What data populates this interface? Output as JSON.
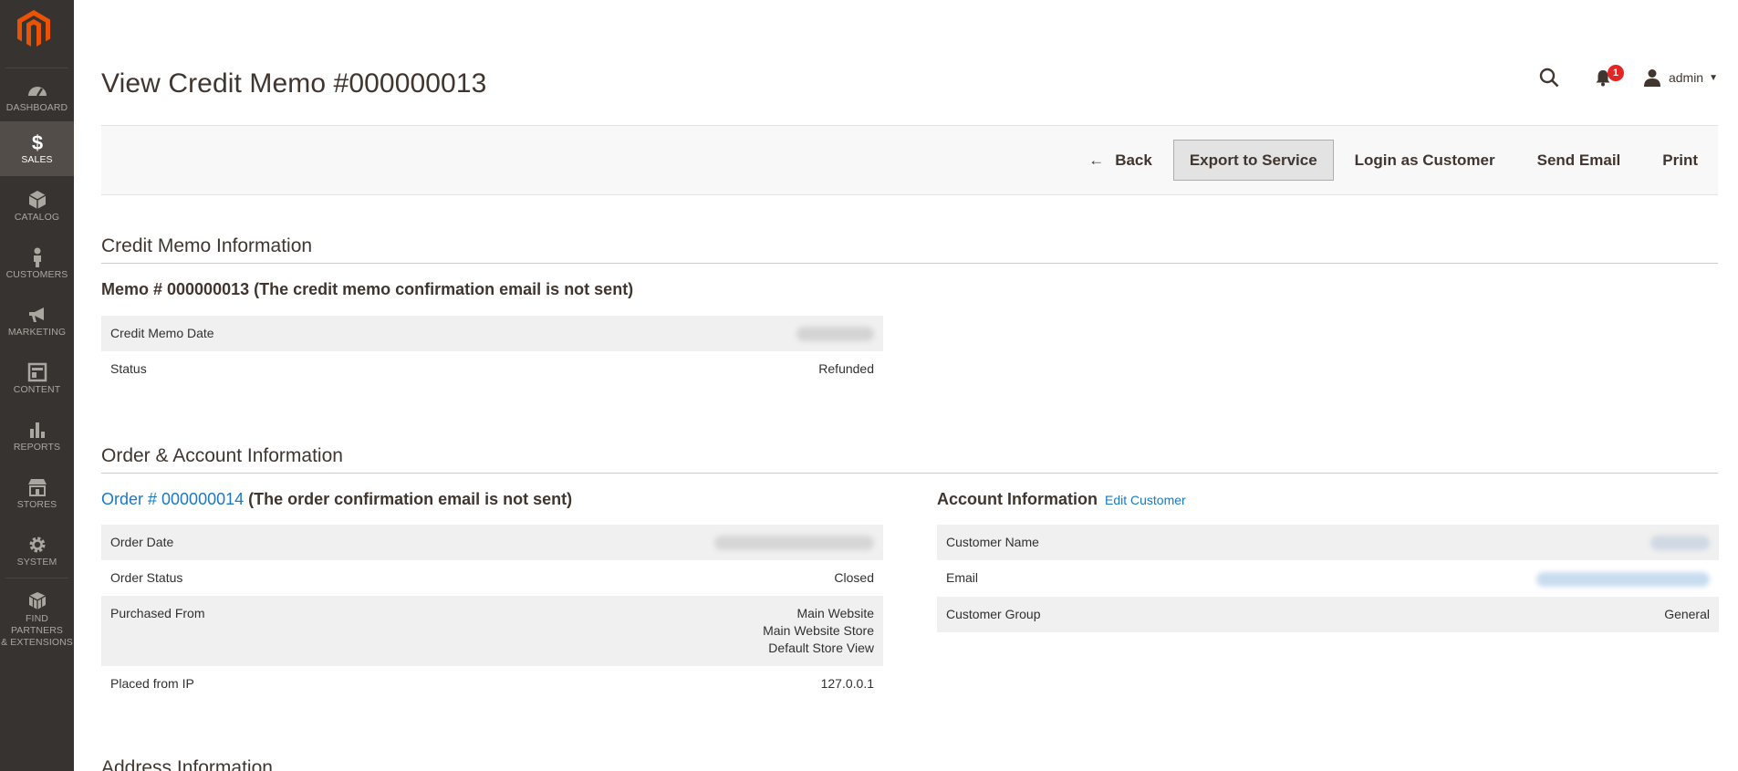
{
  "sidebar": {
    "items": [
      {
        "label": "DASHBOARD"
      },
      {
        "label": "SALES"
      },
      {
        "label": "CATALOG"
      },
      {
        "label": "CUSTOMERS"
      },
      {
        "label": "MARKETING"
      },
      {
        "label": "CONTENT"
      },
      {
        "label": "REPORTS"
      },
      {
        "label": "STORES"
      },
      {
        "label": "SYSTEM"
      },
      {
        "label_line1": "FIND PARTNERS",
        "label_line2": "& EXTENSIONS"
      }
    ],
    "active": "SALES"
  },
  "header": {
    "title": "View Credit Memo #000000013",
    "notifications_count": "1",
    "user": "admin"
  },
  "actions": {
    "back": "Back",
    "export": "Export to Service",
    "login_as_customer": "Login as Customer",
    "send_email": "Send Email",
    "print": "Print"
  },
  "credit_memo": {
    "section_title": "Credit Memo Information",
    "memo_heading": "Memo # 000000013 (The credit memo confirmation email is not sent)",
    "rows": [
      {
        "label": "Credit Memo Date",
        "value": ""
      },
      {
        "label": "Status",
        "value": "Refunded"
      }
    ]
  },
  "order_account": {
    "section_title": "Order & Account Information",
    "order_link": "Order # 000000014",
    "order_note": " (The order confirmation email is not sent)",
    "order_rows": [
      {
        "label": "Order Date",
        "value": ""
      },
      {
        "label": "Order Status",
        "value": "Closed"
      },
      {
        "label": "Purchased From",
        "value_lines": [
          "Main Website",
          "Main Website Store",
          "Default Store View"
        ]
      },
      {
        "label": "Placed from IP",
        "value": "127.0.0.1"
      }
    ],
    "account_title": "Account Information",
    "edit_customer": "Edit Customer",
    "account_rows": [
      {
        "label": "Customer Name",
        "value": ""
      },
      {
        "label": "Email",
        "value": ""
      },
      {
        "label": "Customer Group",
        "value": "General"
      }
    ]
  },
  "address": {
    "section_title": "Address Information"
  },
  "colors": {
    "sidebar_bg": "#373330",
    "sidebar_active": "#524d49",
    "logo": "#eb5202",
    "link": "#1979c3",
    "badge": "#e22626"
  }
}
